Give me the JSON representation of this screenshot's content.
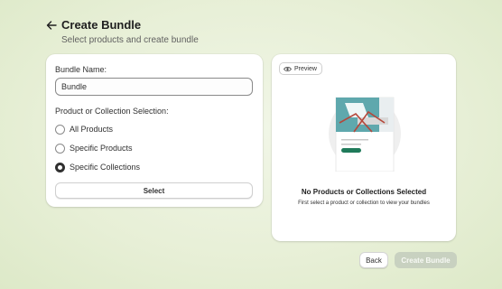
{
  "header": {
    "title": "Create Bundle",
    "subtitle": "Select products and create bundle",
    "back_icon": "arrow-left-icon"
  },
  "form": {
    "name_label": "Bundle Name:",
    "name_value": "Bundle",
    "selection_label": "Product or Collection Selection:",
    "options": [
      {
        "label": "All Products",
        "checked": false
      },
      {
        "label": "Specific Products",
        "checked": false
      },
      {
        "label": "Specific Collections",
        "checked": true
      }
    ],
    "select_button": "Select"
  },
  "preview": {
    "button_label": "Preview",
    "button_icon": "eye-icon",
    "empty_title": "No Products or Collections Selected",
    "empty_description": "First select a product or collection to view your bundles"
  },
  "footer": {
    "back_label": "Back",
    "create_label": "Create Bundle"
  },
  "colors": {
    "background": "#e7efd6",
    "primary_disabled": "#c8d1c0",
    "illustration_teal": "#5fa8ad",
    "illustration_green": "#1f7a5a",
    "illustration_red": "#b5473a"
  }
}
